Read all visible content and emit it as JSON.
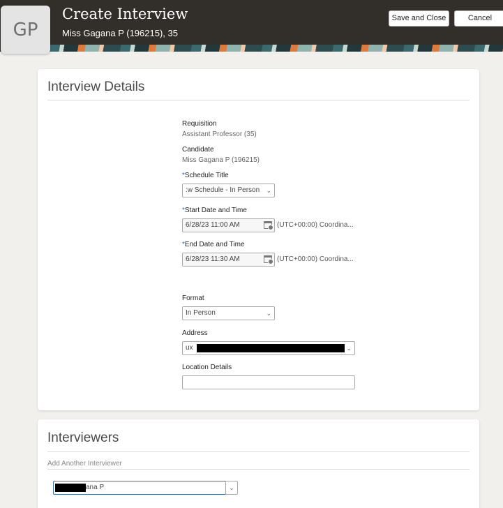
{
  "header": {
    "initials": "GP",
    "title": "Create Interview",
    "subtitle": "Miss Gagana P (196215), 35",
    "save_close_label": "Save and Close",
    "cancel_label": "Cancel"
  },
  "interview_details": {
    "heading": "Interview Details",
    "requisition_label": "Requisition",
    "requisition_value": "Assistant Professor (35)",
    "candidate_label": "Candidate",
    "candidate_value": "Miss Gagana P (196215)",
    "schedule_title_label": "Schedule Title",
    "schedule_title_value": ":w Schedule - In Person",
    "start_label": "Start Date and Time",
    "start_value": "6/28/23 11:00 AM",
    "start_timezone": "(UTC+00:00) Coordina...",
    "end_label": "End Date and Time",
    "end_value": "6/28/23 11:30 AM",
    "end_timezone": "(UTC+00:00) Coordina...",
    "format_label": "Format",
    "format_value": "In Person",
    "address_label": "Address",
    "address_value": "ux",
    "location_label": "Location Details",
    "location_value": ""
  },
  "interviewers": {
    "heading": "Interviewers",
    "add_label": "Add Another Interviewer",
    "interviewer_value": "ana P"
  },
  "colors": {
    "header_bg": "#322e2a",
    "required_marker": "#2c6fb0",
    "page_bg": "#f1f0ec"
  }
}
